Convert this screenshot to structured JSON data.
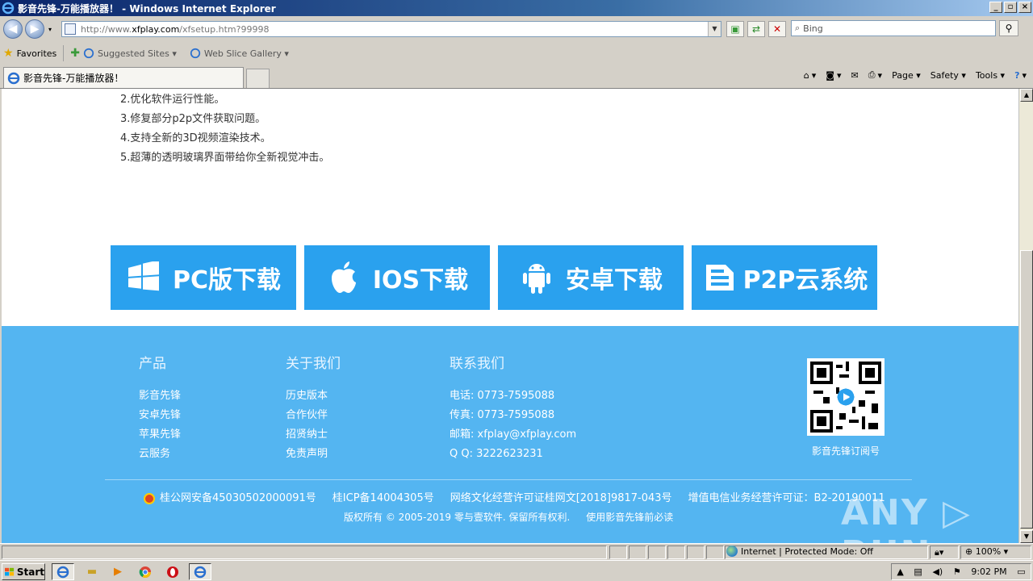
{
  "window": {
    "title": "影音先锋-万能播放器！ - Windows Internet Explorer",
    "controls": {
      "minimize": "_",
      "maximize": "▫",
      "close": "×"
    }
  },
  "address_bar": {
    "url_prefix": "http://www.",
    "url_domain": "xfplay.com",
    "url_path": "/xfsetup.htm?99998"
  },
  "search": {
    "placeholder": "Bing"
  },
  "favorites_bar": {
    "favorites": "Favorites",
    "items": [
      {
        "label": "Suggested Sites ▾"
      },
      {
        "label": "Web Slice Gallery ▾"
      }
    ]
  },
  "tabs": [
    {
      "label": "影音先锋-万能播放器！"
    }
  ],
  "command_bar": {
    "page": "Page ▾",
    "safety": "Safety ▾",
    "tools": "Tools ▾"
  },
  "release_notes": [
    "2.优化软件运行性能。",
    "3.修复部分p2p文件获取问题。",
    "4.支持全新的3D视频渲染技术。",
    "5.超薄的透明玻璃界面带给你全新视觉冲击。"
  ],
  "download_buttons": [
    {
      "label": "PC版下载",
      "icon": "windows-logo-icon"
    },
    {
      "label": "IOS下载",
      "icon": "apple-logo-icon"
    },
    {
      "label": "安卓下载",
      "icon": "android-robot-icon"
    },
    {
      "label": "P2P云系统",
      "icon": "cloud-disk-icon"
    }
  ],
  "footer": {
    "columns": [
      {
        "title": "产品",
        "items": [
          "影音先锋",
          "安卓先锋",
          "苹果先锋",
          "云服务"
        ]
      },
      {
        "title": "关于我们",
        "items": [
          "历史版本",
          "合作伙伴",
          "招贤纳士",
          "免责声明"
        ]
      },
      {
        "title": "联系我们",
        "items": [
          "电话: 0773-7595088",
          "传真: 0773-7595088",
          "邮箱: xfplay@xfplay.com",
          "Q Q: 3222623231"
        ]
      }
    ],
    "qr_caption": "影音先锋订阅号",
    "legal_line1": [
      "桂公网安备45030502000091号",
      "桂ICP备14004305号",
      "网络文化经营许可证桂网文[2018]9817-043号",
      "增值电信业务经营许可证：B2-20190011"
    ],
    "legal_line2": [
      "版权所有 © 2005-2019 零与壹软件. 保留所有权利.",
      "使用影音先锋前必读"
    ]
  },
  "watermark": "ANY ▷ RUN",
  "status_bar": {
    "zone": "Internet | Protected Mode: Off",
    "zoom": "100%"
  },
  "taskbar": {
    "start": "Start",
    "clock": "9:02 PM"
  },
  "colors": {
    "brand_blue": "#2aa1ee",
    "footer_blue": "#54b5f1"
  }
}
